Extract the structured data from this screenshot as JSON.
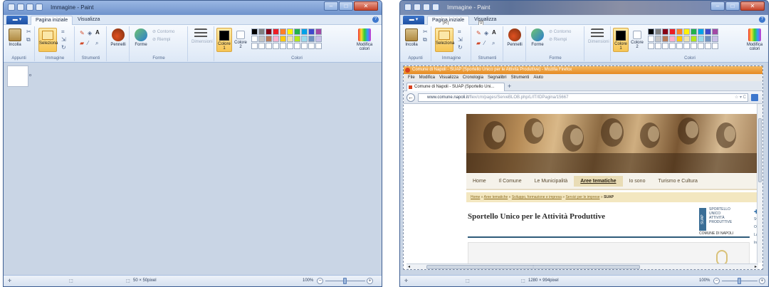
{
  "paint_left": {
    "window_title": "Immagine - Paint",
    "tabs": [
      "Pagina iniziale",
      "Visualizza"
    ],
    "file_menu": "",
    "ribbon": {
      "paste": "Incolla",
      "select": "Seleziona",
      "brushes": "Pennelli",
      "shapes": "Forme",
      "outline": "Contorno",
      "fill": "Riempi",
      "size": "Dimensioni",
      "color1": "Colore 1",
      "color2": "Colore 2",
      "edit_colors": "Modifica colori",
      "groups": [
        "Appunti",
        "Immagine",
        "Strumenti",
        "Forme",
        "Colori"
      ]
    },
    "status": {
      "size": "50 × 50pixel",
      "zoom": "100%"
    }
  },
  "paint_right": {
    "window_title": "Immagine - Paint",
    "tabs": [
      "Pagina iniziale",
      "Visualizza"
    ],
    "key_tips": [
      "H",
      "V"
    ],
    "ribbon": {
      "paste": "Incolla",
      "select": "Seleziona",
      "brushes": "Pennelli",
      "shapes": "Forme",
      "outline": "Contorno",
      "fill": "Riempi",
      "size": "Dimensioni",
      "color1": "Colore 1",
      "color2": "Colore 2",
      "edit_colors": "Modifica colori",
      "groups": [
        "Appunti",
        "Immagine",
        "Strumenti",
        "Forme",
        "Colori"
      ]
    },
    "status": {
      "size": "1280 × 994pixel",
      "zoom": "100%"
    },
    "firefox": {
      "title": "Comune di Napoli - SUAP (Sportello Unico per le Attività Produttive) - Mozilla Firefox",
      "menu": [
        "File",
        "Modifica",
        "Visualizza",
        "Cronologia",
        "Segnalibri",
        "Strumenti",
        "Aiuto"
      ],
      "tab": "Comune di Napoli - SUAP (Sportello Uni...",
      "url_domain": "www.comune.napoli.it",
      "url_path": "/flex/cm/pages/ServeBLOB.php/L/IT/IDPagina/15667",
      "nav": [
        "Home",
        "Il Comune",
        "Le Municipalità",
        "Aree tematiche",
        "Io sono",
        "Turismo e Cultura"
      ],
      "breadcrumb": [
        "Home",
        "Aree tematiche",
        "Sviluppo, formazione e impresa",
        "Servizi per le imprese",
        "SUAP"
      ],
      "heading": "Sportello Unico per le Attività Produttive",
      "suap_word": "SUAP",
      "suap_lines": [
        "SPORTELLO",
        "UNICO",
        "ATTIVITÀ",
        "PRODUTTIVE"
      ],
      "suap_city": "COMUNE DI NAPOLI",
      "side_links": [
        "Svil",
        "Of",
        "La",
        "In"
      ]
    }
  },
  "palette": [
    "#000000",
    "#7f7f7f",
    "#880015",
    "#ed1c24",
    "#ff7f27",
    "#fff200",
    "#22b14c",
    "#00a2e8",
    "#3f48cc",
    "#a349a4",
    "#ffffff",
    "#c3c3c3",
    "#b97a57",
    "#ffaec9",
    "#ffc90e",
    "#efe4b0",
    "#b5e61d",
    "#99d9ea",
    "#7092be",
    "#c8bfe7"
  ]
}
